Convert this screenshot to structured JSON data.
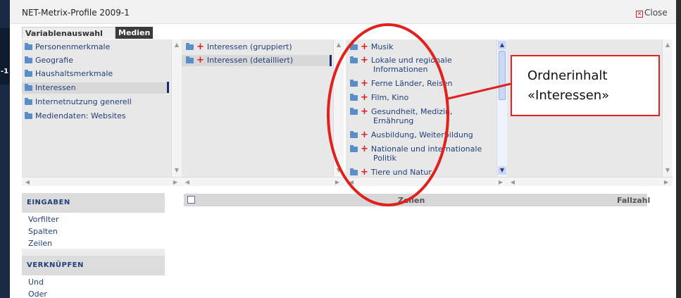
{
  "window": {
    "title": "NET-Metrix-Profile 2009-1",
    "close_label": "Close",
    "close_icon": "close-box-icon"
  },
  "background": {
    "edge_text": "-1"
  },
  "tabs": [
    {
      "label": "Variablenauswahl",
      "active": true
    },
    {
      "label": "Medien",
      "active": false
    }
  ],
  "columns": {
    "categories": [
      {
        "label": "Personenmerkmale",
        "selected": false
      },
      {
        "label": "Geografie",
        "selected": false
      },
      {
        "label": "Haushaltsmerkmale",
        "selected": false
      },
      {
        "label": "Interessen",
        "selected": true
      },
      {
        "label": "Internetnutzung generell",
        "selected": false
      },
      {
        "label": "Mediendaten: Websites",
        "selected": false
      }
    ],
    "subcategories": [
      {
        "label": "Interessen (gruppiert)",
        "selected": false
      },
      {
        "label": "Interessen (detailliert)",
        "selected": true
      }
    ],
    "contents": [
      {
        "line1": "Musik",
        "line2": ""
      },
      {
        "line1": "Lokale und regionale",
        "line2": "Informationen"
      },
      {
        "line1": "Ferne Länder, Reisen",
        "line2": ""
      },
      {
        "line1": "Film, Kino",
        "line2": ""
      },
      {
        "line1": "Gesundheit, Medizin,",
        "line2": "Ernährung"
      },
      {
        "line1": "Ausbildung, Weiterbildung",
        "line2": ""
      },
      {
        "line1": "Nationale und internationale",
        "line2": "Politik"
      },
      {
        "line1": "Tiere und Natur",
        "line2": ""
      }
    ]
  },
  "sidebar": {
    "eingaben_title": "EINGABEN",
    "eingaben_items": [
      "Vorfilter",
      "Spalten",
      "Zeilen"
    ],
    "verknuepfen_title": "VERKNÜPFEN",
    "verknuepfen_items": [
      "Und",
      "Oder"
    ]
  },
  "grid": {
    "col_zeilen": "Zeilen",
    "col_fallzahl": "Fallzahl"
  },
  "annotation": {
    "line1": "Ordnerinhalt",
    "line2": "«Interessen»",
    "color": "#e0211d"
  },
  "colors": {
    "link": "#22407a",
    "plus": "#d42020",
    "folder": "#5a8ec8",
    "highlight": "#e0211d"
  }
}
